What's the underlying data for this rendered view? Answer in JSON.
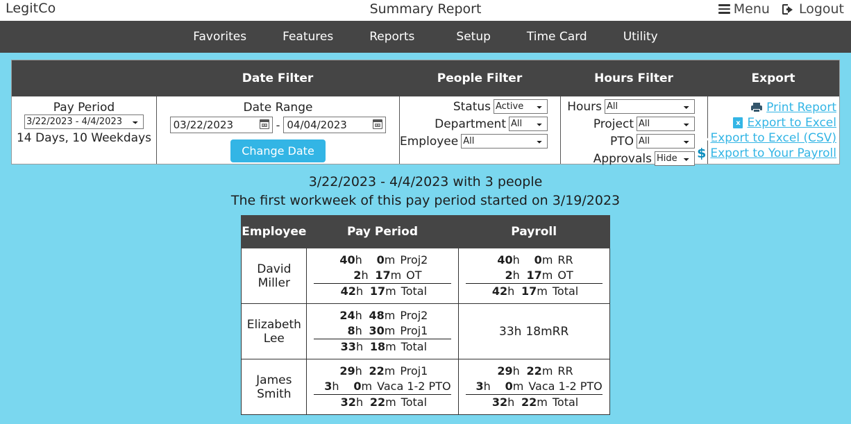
{
  "topbar": {
    "brand": "LegitCo",
    "title": "Summary Report",
    "menu_label": "Menu",
    "logout_label": "Logout"
  },
  "nav": {
    "items": [
      {
        "label": "Favorites"
      },
      {
        "label": "Features"
      },
      {
        "label": "Reports"
      },
      {
        "label": "Setup"
      },
      {
        "label": "Time Card"
      },
      {
        "label": "Utility"
      }
    ]
  },
  "filter_panel": {
    "headers": {
      "date_filter": "Date Filter",
      "people_filter": "People Filter",
      "hours_filter": "Hours Filter",
      "export": "Export"
    },
    "pay_period": {
      "title": "Pay Period",
      "selected": "3/22/2023 - 4/4/2023",
      "note": "14 Days, 10 Weekdays"
    },
    "date_range": {
      "title": "Date Range",
      "start": "03/22/2023",
      "end": "04/04/2023",
      "separator": "-",
      "button": "Change Date",
      "calendar_icon": "calendar-icon"
    },
    "people": {
      "status_label": "Status",
      "status_value": "Active",
      "department_label": "Department",
      "department_value": "All",
      "employee_label": "Employee",
      "employee_value": "All"
    },
    "hours": {
      "hours_label": "Hours",
      "hours_value": "All",
      "project_label": "Project",
      "project_value": "All",
      "pto_label": "PTO",
      "pto_value": "All",
      "approvals_label": "Approvals",
      "approvals_value": "Hide"
    },
    "export_links": [
      {
        "label": "Print Report",
        "icon": "printer-icon"
      },
      {
        "label": "Export to Excel",
        "icon": "excel-file-icon"
      },
      {
        "label": "Export to Excel (CSV)",
        "icon": "csv-file-icon"
      },
      {
        "label": "Export to Your Payroll",
        "icon": "dollar-icon"
      }
    ],
    "accent_color": "#33b5e5",
    "header_color": "#454545"
  },
  "summary": {
    "line1": "3/22/2023 - 4/4/2023 with 3 people",
    "line2": "The first workweek of this pay period started on 3/19/2023"
  },
  "results_table": {
    "columns": [
      "Employee",
      "Pay Period",
      "Payroll"
    ],
    "rows": [
      {
        "employee": "David Miller",
        "pay_period": [
          {
            "h": "40",
            "m": "0",
            "label": "Proj2",
            "rule": false
          },
          {
            "h": "2",
            "m": "17",
            "label": "OT",
            "rule": true
          },
          {
            "h": "42",
            "m": "17",
            "label": "Total",
            "rule": false
          }
        ],
        "payroll": [
          {
            "h": "40",
            "m": "0",
            "label": "RR",
            "rule": false
          },
          {
            "h": "2",
            "m": "17",
            "label": "OT",
            "rule": true
          },
          {
            "h": "42",
            "m": "17",
            "label": "Total",
            "rule": false
          }
        ]
      },
      {
        "employee": "Elizabeth Lee",
        "pay_period": [
          {
            "h": "24",
            "m": "48",
            "label": "Proj2",
            "rule": false
          },
          {
            "h": "8",
            "m": "30",
            "label": "Proj1",
            "rule": true
          },
          {
            "h": "33",
            "m": "18",
            "label": "Total",
            "rule": false
          }
        ],
        "payroll": [
          {
            "h": "33",
            "m": "18",
            "label": "RR",
            "rule": false
          }
        ]
      },
      {
        "employee": "James Smith",
        "pay_period": [
          {
            "h": "29",
            "m": "22",
            "label": "Proj1",
            "rule": false
          },
          {
            "h": "3",
            "m": "0",
            "label": "Vaca 1-2 PTO",
            "rule": true
          },
          {
            "h": "32",
            "m": "22",
            "label": "Total",
            "rule": false
          }
        ],
        "payroll": [
          {
            "h": "29",
            "m": "22",
            "label": "RR",
            "rule": false
          },
          {
            "h": "3",
            "m": "0",
            "label": "Vaca 1-2 PTO",
            "rule": true
          },
          {
            "h": "32",
            "m": "22",
            "label": "Total",
            "rule": false
          }
        ]
      }
    ],
    "units": {
      "hours": "h",
      "minutes": "m"
    }
  },
  "page": {
    "background_color": "#7ad7ef"
  }
}
